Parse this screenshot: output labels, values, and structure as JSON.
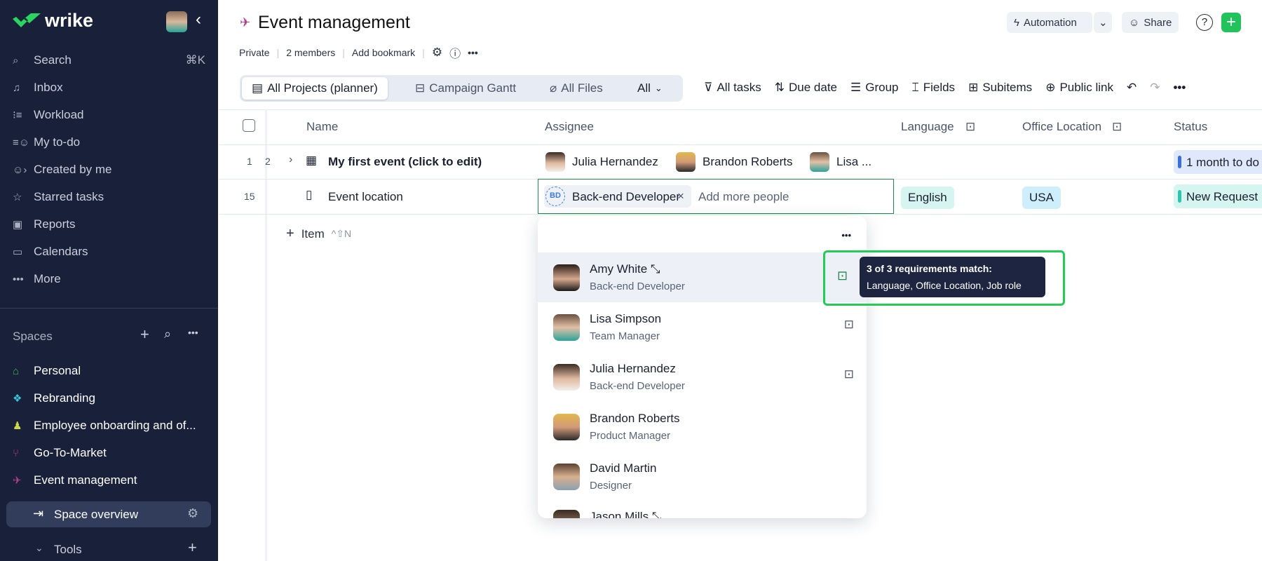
{
  "sidebar": {
    "brand": "wrike",
    "nav": [
      {
        "label": "Search",
        "icon": "search-icon",
        "shortcut": "⌘K"
      },
      {
        "label": "Inbox",
        "icon": "bell-icon"
      },
      {
        "label": "Workload",
        "icon": "workload-icon"
      },
      {
        "label": "My to-do",
        "icon": "todo-icon"
      },
      {
        "label": "Created by me",
        "icon": "created-icon"
      },
      {
        "label": "Starred tasks",
        "icon": "star-icon"
      },
      {
        "label": "Reports",
        "icon": "reports-icon"
      },
      {
        "label": "Calendars",
        "icon": "calendar-icon"
      },
      {
        "label": "More",
        "icon": "more-icon"
      }
    ],
    "spaces_label": "Spaces",
    "spaces": [
      {
        "label": "Personal",
        "color": "#3fae5a"
      },
      {
        "label": "Rebranding",
        "color": "#3cc4d6"
      },
      {
        "label": "Employee onboarding and of...",
        "color": "#c8d94a"
      },
      {
        "label": "Go-To-Market",
        "color": "#c0397a"
      },
      {
        "label": "Event management",
        "color": "#b0408a"
      }
    ],
    "space_overview": "Space overview",
    "tools": "Tools"
  },
  "header": {
    "title": "Event management",
    "meta": [
      "Private",
      "2 members",
      "Add bookmark"
    ],
    "automation": "Automation",
    "share": "Share"
  },
  "views": {
    "tabs": [
      "All Projects (planner)",
      "Campaign Gantt",
      "All Files"
    ],
    "all": "All"
  },
  "toolbar": [
    "All tasks",
    "Due date",
    "Group",
    "Fields",
    "Subitems",
    "Public link"
  ],
  "table": {
    "columns": [
      "Name",
      "Assignee",
      "Language",
      "Office Location",
      "Status"
    ],
    "rows": [
      {
        "num": "1",
        "sub": "2",
        "name": "My first event (click to edit)",
        "assignees": [
          "Julia Hernandez",
          "Brandon Roberts",
          "Lisa ..."
        ],
        "status": "1 month to do",
        "status_color": "#3b6fd8"
      },
      {
        "num": "15",
        "name": "Event location",
        "chip_initials": "BD",
        "chip": "Back-end Developer",
        "placeholder": "Add more people",
        "language": "English",
        "office": "USA",
        "status": "New Request",
        "status_color": "#2fc4b2"
      }
    ],
    "add_item": "Item",
    "add_shortcut": "^⇧N"
  },
  "dropdown": {
    "people": [
      {
        "name": "Amy White",
        "role": "Back-end Developer"
      },
      {
        "name": "Lisa Simpson",
        "role": "Team Manager"
      },
      {
        "name": "Julia Hernandez",
        "role": "Back-end Developer"
      },
      {
        "name": "Brandon Roberts",
        "role": "Product Manager"
      },
      {
        "name": "David Martin",
        "role": "Designer"
      },
      {
        "name": "Jason Mills",
        "role": ""
      }
    ]
  },
  "tooltip": {
    "title": "3 of 3 requirements match:",
    "body": "Language, Office Location, Job role"
  }
}
